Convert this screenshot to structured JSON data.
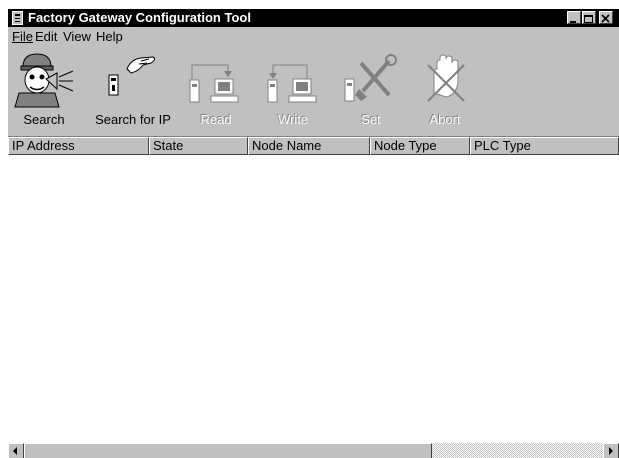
{
  "window": {
    "title": "Factory Gateway Configuration Tool",
    "icon": "app-icon"
  },
  "menu": [
    {
      "label": "File"
    },
    {
      "label": "Edit"
    },
    {
      "label": "View"
    },
    {
      "label": "Help"
    }
  ],
  "toolbar": {
    "search": {
      "label": "Search",
      "icon": "search-person-icon",
      "enabled": true
    },
    "search_ip": {
      "label": "Search for IP",
      "icon": "search-ip-icon",
      "enabled": true
    },
    "read": {
      "label": "Read",
      "icon": "read-icon",
      "enabled": false
    },
    "write": {
      "label": "Write",
      "icon": "write-icon",
      "enabled": false
    },
    "set": {
      "label": "Set",
      "icon": "set-tools-icon",
      "enabled": false
    },
    "abort": {
      "label": "Abort",
      "icon": "abort-hand-icon",
      "enabled": false
    }
  },
  "list": {
    "columns": [
      "IP Address",
      "State",
      "Node Name",
      "Node Type",
      "PLC Type"
    ],
    "rows": []
  },
  "colors": {
    "titlebar": "#000000",
    "face": "#c0c0c0",
    "disabled_text": "#808080"
  }
}
